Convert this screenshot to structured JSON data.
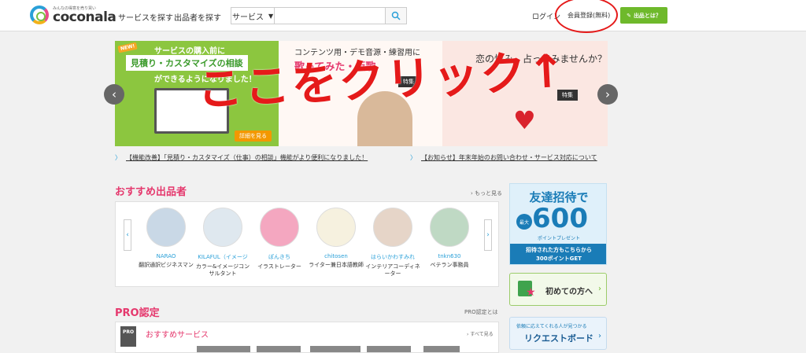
{
  "header": {
    "logo_tagline": "みんなの得意を売り買い",
    "logo_name": "coconala",
    "nav": [
      "サービスを探す",
      "出品者を探す"
    ],
    "search_category": "サービス",
    "search_value": "",
    "login": "ログイン",
    "register": "会員登録(無料)",
    "pro_button": "出品とは？"
  },
  "annotation_text": "ここをクリック↑",
  "carousel": {
    "slide1": {
      "badge": "NEW!",
      "line1": "サービスの購入前に",
      "line2": "見積り・カスタマイズの相談",
      "line3": "ができるようになりました！",
      "button": "詳細を見る"
    },
    "slide2": {
      "line1": "コンテンツ用・デモ音源・練習用に",
      "line2": "歌ってみた・仮歌",
      "tag": "特集"
    },
    "slide3": {
      "line1": "恋の悩み、占ってみませんか？",
      "tag": "特集"
    }
  },
  "news": [
    "【機能改善】「見積り・カスタマイズ（仕事）の相談」機能がより便利になりました！",
    "【お知らせ】年末年始のお問い合わせ・サービス対応について"
  ],
  "sellers_section": {
    "title": "おすすめ出品者",
    "more": "もっと見る",
    "sellers": [
      {
        "name": "NARAO",
        "desc": "翻訳通訳ビジネスマン"
      },
      {
        "name": "KILAFUL（イメージ",
        "desc": "カラー&イメージコンサルタント"
      },
      {
        "name": "ぽんきち",
        "desc": "イラストレーター"
      },
      {
        "name": "chitosen",
        "desc": "ライター兼日本語教師"
      },
      {
        "name": "はらいかわすみれ",
        "desc": "インテリアコーディネーター"
      },
      {
        "name": "tnkn630",
        "desc": "ベテラン事務員"
      }
    ]
  },
  "pro_section": {
    "title": "PRO認定",
    "link": "PRO認定とは",
    "badge": "PRO",
    "sub_title": "おすすめサービス",
    "all_link": "すべて見る"
  },
  "ads": {
    "invite_title": "友達招待で",
    "invite_max": "最大",
    "invite_number": "600",
    "invite_points": "ポイントプレゼント",
    "invite_band_1": "招待された方もこちらから",
    "invite_band_2": "300ポイントGET",
    "first_time": "初めての方へ",
    "request_sub": "依頼に応えてくれる人が見つかる",
    "request_title": "リクエストボード"
  },
  "colors": {
    "brand_pink": "#e5386d",
    "brand_blue": "#2aa0d8",
    "brand_green": "#6eb92b",
    "annotation_red": "#e51a1a"
  }
}
